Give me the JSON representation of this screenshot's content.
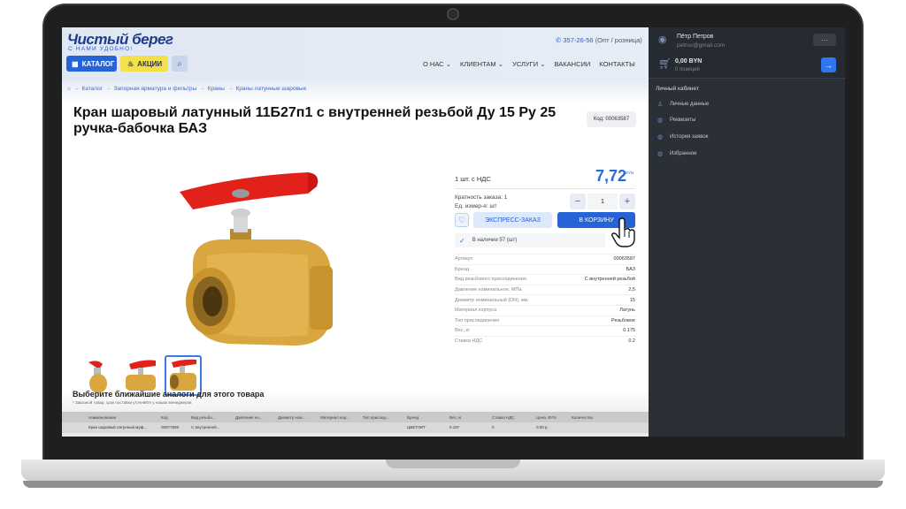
{
  "header": {
    "logo": "Чистый берег",
    "logo_sub": "С НАМИ УДОБНО!",
    "catalog_label": "КАТАЛОГ",
    "promo_label": "АКЦИИ",
    "phone": "357-26-56",
    "phone_note": "(Опт / розница)",
    "nav": [
      "О НАС",
      "КЛИЕНТАМ",
      "УСЛУГИ",
      "ВАКАНСИИ",
      "КОНТАКТЫ"
    ]
  },
  "breadcrumbs": [
    "Каталог",
    "Запорная арматура и фильтры",
    "Краны",
    "Краны латунные шаровые"
  ],
  "product": {
    "title": "Кран шаровый латунный 11Б27п1 с внутренней резьбой Ду 15 Ру 25 ручка-бабочка БАЗ",
    "code": "Код: 00063587",
    "unit_price_label": "1 шт. с НДС",
    "price": "7,72",
    "currency": "BYN",
    "order_multiplicity": "Кратность заказа: 1",
    "unit": "Ед. измер-я: шт",
    "quantity": "1",
    "express_label": "ЭКСПРЕСС-ЗАКАЗ",
    "cart_label": "В КОРЗИНУ",
    "stock": "В наличии 57 (шт)",
    "specs": [
      {
        "k": "Артикул",
        "v": "00063587"
      },
      {
        "k": "Бренд",
        "v": "БАЗ"
      },
      {
        "k": "Вид резьбового присоединения",
        "v": "С внутренней резьбой"
      },
      {
        "k": "Давление номинальное, МПа",
        "v": "2,5"
      },
      {
        "k": "Диаметр номинальный (DN), мм",
        "v": "15"
      },
      {
        "k": "Материал корпуса",
        "v": "Латунь"
      },
      {
        "k": "Тип присоединения",
        "v": "Резьбовое"
      },
      {
        "k": "Вес, кг",
        "v": "0.175"
      },
      {
        "k": "Ставка НДС",
        "v": "0.2"
      }
    ]
  },
  "analogs": {
    "title": "Выберите ближайшие аналоги для этого товара",
    "note": "* Заказной товар, срок поставки уточняйте у наших менеджеров",
    "headers": [
      "Наименование",
      "Код",
      "Вид резьбо...",
      "Давление но...",
      "Диаметр ном...",
      "Материал кор...",
      "Тип присоед...",
      "Бренд",
      "Вес, кг",
      "Ставка НДС",
      "Цена, BYN",
      "Количество"
    ],
    "row": [
      "Кран шаровый латунный муф...",
      "00077808",
      "С внутренней...",
      "",
      "",
      "",
      "",
      "ЦВЕТЛИТ",
      "0.197",
      "0",
      "0,00 р."
    ]
  },
  "account": {
    "name": "Пётр Петров",
    "email": "petrov@gmail.com",
    "more": "···",
    "cart_sum": "0,00 BYN",
    "cart_count": "0 позиций",
    "cabinet_title": "Личный кабинет",
    "items": [
      "Личные данные",
      "Реквизиты",
      "История заявок",
      "Избранное"
    ]
  }
}
